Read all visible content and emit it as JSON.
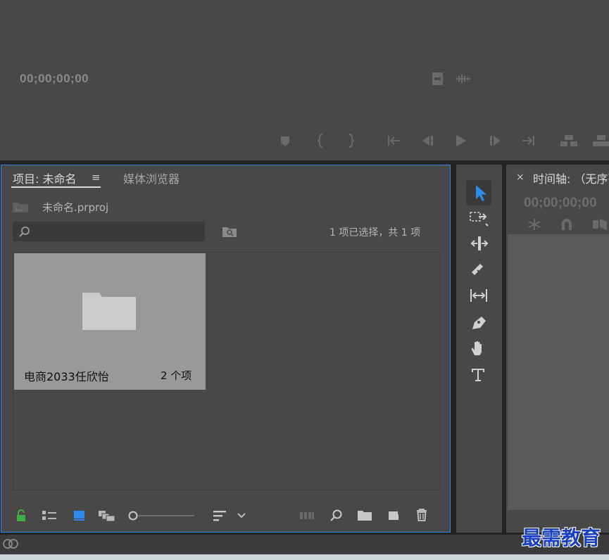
{
  "monitor": {
    "timecode": "00;00;00;00"
  },
  "project_panel": {
    "tab_project_label": "项目: 未命名",
    "tab_menu_glyph": "≡",
    "tab_media_label": "媒体浏览器",
    "project_file": "未命名.prproj",
    "search_placeholder": "",
    "selection_status": "1 项已选择，共 1 项",
    "bin": {
      "name": "电商2033任欣怡",
      "count": "2 个项"
    }
  },
  "tools": [
    "selection-tool",
    "track-select-tool",
    "ripple-edit-tool",
    "razor-tool",
    "slip-tool",
    "pen-tool",
    "hand-tool",
    "type-tool"
  ],
  "timeline": {
    "close_glyph": "×",
    "title": "时间轴: （无序列）",
    "timecode": "00;00;00;00"
  },
  "watermark": "最需教育",
  "colors": {
    "panel_bg": "#484848",
    "accent_blue": "#2d8ceb",
    "bin_tile": "#999999",
    "lock_green": "#3fae3f"
  }
}
